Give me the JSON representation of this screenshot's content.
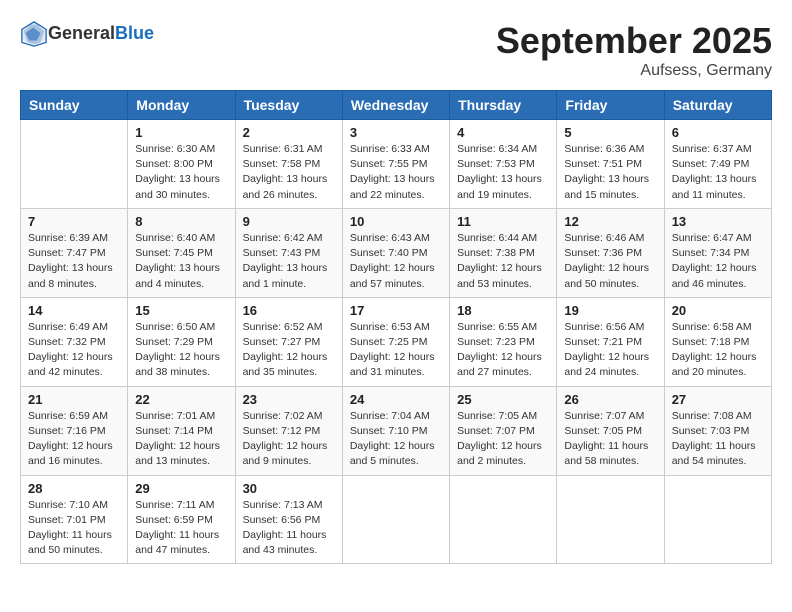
{
  "header": {
    "logo_general": "General",
    "logo_blue": "Blue",
    "month": "September 2025",
    "location": "Aufsess, Germany"
  },
  "weekdays": [
    "Sunday",
    "Monday",
    "Tuesday",
    "Wednesday",
    "Thursday",
    "Friday",
    "Saturday"
  ],
  "weeks": [
    [
      {
        "day": "",
        "info": ""
      },
      {
        "day": "1",
        "info": "Sunrise: 6:30 AM\nSunset: 8:00 PM\nDaylight: 13 hours\nand 30 minutes."
      },
      {
        "day": "2",
        "info": "Sunrise: 6:31 AM\nSunset: 7:58 PM\nDaylight: 13 hours\nand 26 minutes."
      },
      {
        "day": "3",
        "info": "Sunrise: 6:33 AM\nSunset: 7:55 PM\nDaylight: 13 hours\nand 22 minutes."
      },
      {
        "day": "4",
        "info": "Sunrise: 6:34 AM\nSunset: 7:53 PM\nDaylight: 13 hours\nand 19 minutes."
      },
      {
        "day": "5",
        "info": "Sunrise: 6:36 AM\nSunset: 7:51 PM\nDaylight: 13 hours\nand 15 minutes."
      },
      {
        "day": "6",
        "info": "Sunrise: 6:37 AM\nSunset: 7:49 PM\nDaylight: 13 hours\nand 11 minutes."
      }
    ],
    [
      {
        "day": "7",
        "info": "Sunrise: 6:39 AM\nSunset: 7:47 PM\nDaylight: 13 hours\nand 8 minutes."
      },
      {
        "day": "8",
        "info": "Sunrise: 6:40 AM\nSunset: 7:45 PM\nDaylight: 13 hours\nand 4 minutes."
      },
      {
        "day": "9",
        "info": "Sunrise: 6:42 AM\nSunset: 7:43 PM\nDaylight: 13 hours\nand 1 minute."
      },
      {
        "day": "10",
        "info": "Sunrise: 6:43 AM\nSunset: 7:40 PM\nDaylight: 12 hours\nand 57 minutes."
      },
      {
        "day": "11",
        "info": "Sunrise: 6:44 AM\nSunset: 7:38 PM\nDaylight: 12 hours\nand 53 minutes."
      },
      {
        "day": "12",
        "info": "Sunrise: 6:46 AM\nSunset: 7:36 PM\nDaylight: 12 hours\nand 50 minutes."
      },
      {
        "day": "13",
        "info": "Sunrise: 6:47 AM\nSunset: 7:34 PM\nDaylight: 12 hours\nand 46 minutes."
      }
    ],
    [
      {
        "day": "14",
        "info": "Sunrise: 6:49 AM\nSunset: 7:32 PM\nDaylight: 12 hours\nand 42 minutes."
      },
      {
        "day": "15",
        "info": "Sunrise: 6:50 AM\nSunset: 7:29 PM\nDaylight: 12 hours\nand 38 minutes."
      },
      {
        "day": "16",
        "info": "Sunrise: 6:52 AM\nSunset: 7:27 PM\nDaylight: 12 hours\nand 35 minutes."
      },
      {
        "day": "17",
        "info": "Sunrise: 6:53 AM\nSunset: 7:25 PM\nDaylight: 12 hours\nand 31 minutes."
      },
      {
        "day": "18",
        "info": "Sunrise: 6:55 AM\nSunset: 7:23 PM\nDaylight: 12 hours\nand 27 minutes."
      },
      {
        "day": "19",
        "info": "Sunrise: 6:56 AM\nSunset: 7:21 PM\nDaylight: 12 hours\nand 24 minutes."
      },
      {
        "day": "20",
        "info": "Sunrise: 6:58 AM\nSunset: 7:18 PM\nDaylight: 12 hours\nand 20 minutes."
      }
    ],
    [
      {
        "day": "21",
        "info": "Sunrise: 6:59 AM\nSunset: 7:16 PM\nDaylight: 12 hours\nand 16 minutes."
      },
      {
        "day": "22",
        "info": "Sunrise: 7:01 AM\nSunset: 7:14 PM\nDaylight: 12 hours\nand 13 minutes."
      },
      {
        "day": "23",
        "info": "Sunrise: 7:02 AM\nSunset: 7:12 PM\nDaylight: 12 hours\nand 9 minutes."
      },
      {
        "day": "24",
        "info": "Sunrise: 7:04 AM\nSunset: 7:10 PM\nDaylight: 12 hours\nand 5 minutes."
      },
      {
        "day": "25",
        "info": "Sunrise: 7:05 AM\nSunset: 7:07 PM\nDaylight: 12 hours\nand 2 minutes."
      },
      {
        "day": "26",
        "info": "Sunrise: 7:07 AM\nSunset: 7:05 PM\nDaylight: 11 hours\nand 58 minutes."
      },
      {
        "day": "27",
        "info": "Sunrise: 7:08 AM\nSunset: 7:03 PM\nDaylight: 11 hours\nand 54 minutes."
      }
    ],
    [
      {
        "day": "28",
        "info": "Sunrise: 7:10 AM\nSunset: 7:01 PM\nDaylight: 11 hours\nand 50 minutes."
      },
      {
        "day": "29",
        "info": "Sunrise: 7:11 AM\nSunset: 6:59 PM\nDaylight: 11 hours\nand 47 minutes."
      },
      {
        "day": "30",
        "info": "Sunrise: 7:13 AM\nSunset: 6:56 PM\nDaylight: 11 hours\nand 43 minutes."
      },
      {
        "day": "",
        "info": ""
      },
      {
        "day": "",
        "info": ""
      },
      {
        "day": "",
        "info": ""
      },
      {
        "day": "",
        "info": ""
      }
    ]
  ]
}
